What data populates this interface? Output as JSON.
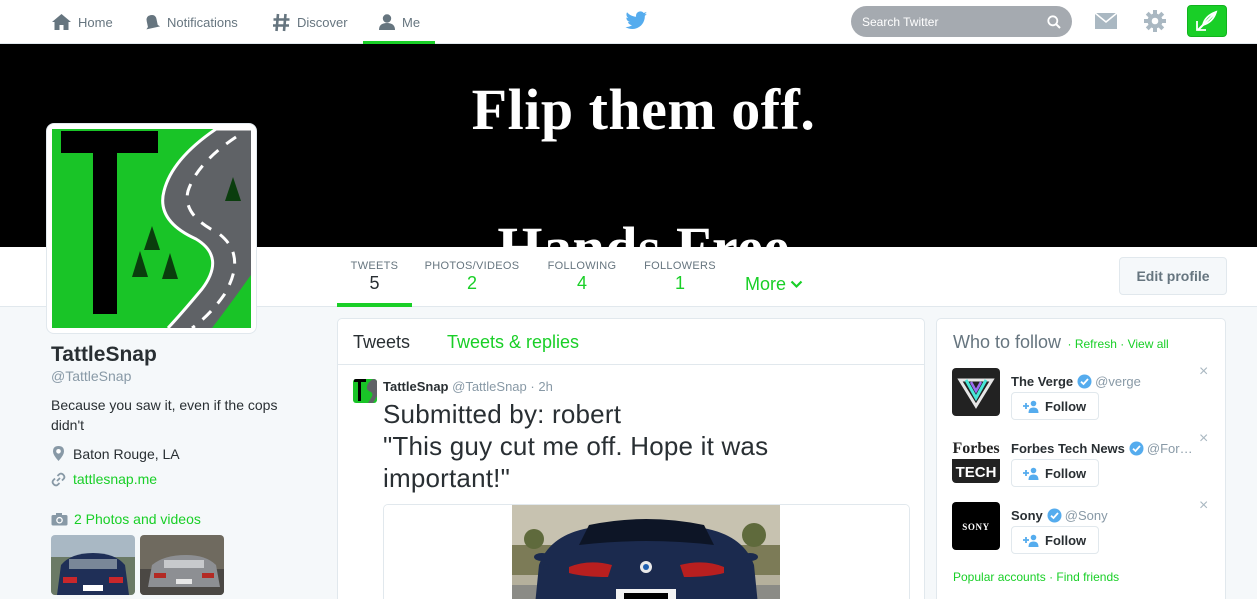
{
  "nav": {
    "home": "Home",
    "notifications": "Notifications",
    "discover": "Discover",
    "me": "Me",
    "search_placeholder": "Search Twitter"
  },
  "banner": {
    "line1": "Flip them off.",
    "line2": "Hands Free"
  },
  "stats": {
    "tweets_label": "TWEETS",
    "tweets": "5",
    "photos_label": "PHOTOS/VIDEOS",
    "photos": "2",
    "following_label": "FOLLOWING",
    "following": "4",
    "followers_label": "FOLLOWERS",
    "followers": "1",
    "more": "More",
    "edit_profile": "Edit profile"
  },
  "profile": {
    "name": "TattleSnap",
    "handle": "@TattleSnap",
    "bio": "Because you saw it, even if the cops didn't",
    "location": "Baton Rouge, LA",
    "url": "tattlesnap.me",
    "photos_link": "2 Photos and videos"
  },
  "timeline": {
    "tab_tweets": "Tweets",
    "tab_replies": "Tweets & replies",
    "tweet": {
      "name": "TattleSnap",
      "handle": "@TattleSnap",
      "sep": "·",
      "time": "2h",
      "line1": "Submitted by: robert",
      "line2": "\"This guy cut me off. Hope it was important!\""
    }
  },
  "who_to_follow": {
    "title": "Who to follow",
    "refresh": "Refresh",
    "view_all": "View all",
    "sep": "·",
    "follow_label": "Follow",
    "dismiss": "×",
    "users": [
      {
        "name": "The Verge",
        "handle": "@verge"
      },
      {
        "name": "Forbes Tech News",
        "handle": "@For…",
        "logo_top": "Forbes",
        "logo_bottom": "TECH"
      },
      {
        "name": "Sony",
        "handle": "@Sony",
        "logo": "SONY"
      }
    ],
    "popular": "Popular accounts",
    "find_friends": "Find friends"
  },
  "colors": {
    "accent": "#19cf27",
    "text": "#292f33",
    "muted": "#8899a6",
    "verified": "#55acee"
  }
}
